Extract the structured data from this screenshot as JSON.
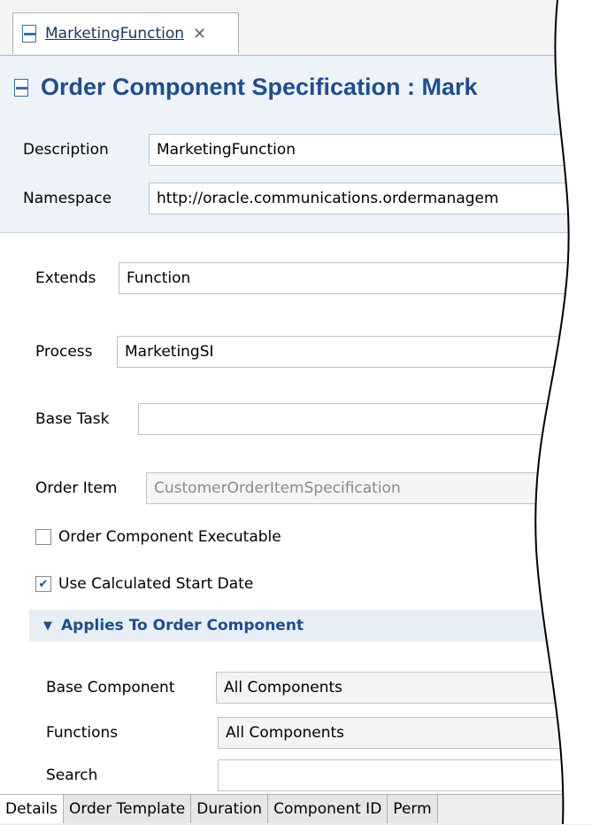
{
  "editor_tab": {
    "label": "MarketingFunction",
    "close_glyph": "✕"
  },
  "title": "Order Component Specification : Mark",
  "header_fields": {
    "description_label": "Description",
    "description_value": "MarketingFunction",
    "namespace_label": "Namespace",
    "namespace_value": "http://oracle.communications.ordermanagem"
  },
  "fields": {
    "extends_label": "Extends",
    "extends_value": "Function",
    "process_label": "Process",
    "process_value": "MarketingSI",
    "base_task_label": "Base Task",
    "base_task_value": "",
    "order_item_label": "Order Item",
    "order_item_value": "CustomerOrderItemSpecification"
  },
  "checkboxes": {
    "executable_label": "Order Component Executable",
    "executable_checked": false,
    "calc_start_label": "Use Calculated Start Date",
    "calc_start_checked": true
  },
  "section": {
    "title": "Applies To Order Component",
    "base_component_label": "Base Component",
    "base_component_value": "All Components",
    "functions_label": "Functions",
    "functions_value": "All Components",
    "search_label": "Search",
    "search_value": ""
  },
  "bottom_tabs": [
    "Details",
    "Order Template",
    "Duration",
    "Component ID",
    "Perm"
  ],
  "colors": {
    "accent": "#1f4e8c",
    "header_bg": "#eef3f9",
    "section_bg": "#e7eef6"
  }
}
